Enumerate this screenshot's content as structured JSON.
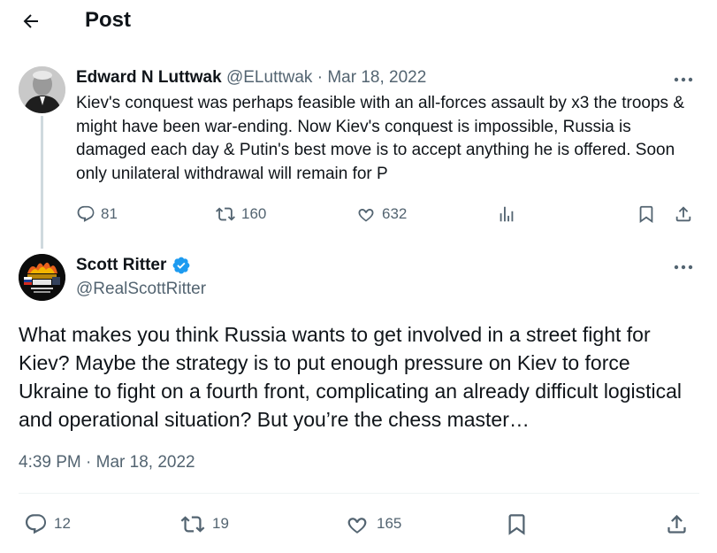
{
  "header": {
    "title": "Post",
    "back_icon": "arrow-left-icon"
  },
  "quoted_post": {
    "author_name": "Edward N Luttwak",
    "handle": "@ELuttwak",
    "separator": "·",
    "date": "Mar 18, 2022",
    "text": "Kiev's conquest was perhaps feasible with an all-forces assault by x3 the troops & might have been war-ending. Now Kiev's conquest is impossible, Russia is damaged each day & Putin's best move is to accept anything he is offered. Soon only unilateral withdrawal will remain for P",
    "replies": "81",
    "reposts": "160",
    "likes": "632"
  },
  "main_post": {
    "author_name": "Scott Ritter",
    "handle": "@RealScottRitter",
    "verified": true,
    "text": "What makes you think Russia wants to get involved in a street fight for Kiev? Maybe the strategy is to put enough pressure on Kiev to force Ukraine to fight on a fourth front, complicating an already difficult logistical and operational situation? But you’re the chess master…",
    "timestamp": "4:39 PM · Mar 18, 2022",
    "replies": "12",
    "reposts": "19",
    "likes": "165"
  },
  "colors": {
    "text": "#0f1419",
    "muted": "#536471",
    "verified": "#1d9bf0",
    "divider": "#eff3f4",
    "thread_line": "#cfd9de"
  }
}
